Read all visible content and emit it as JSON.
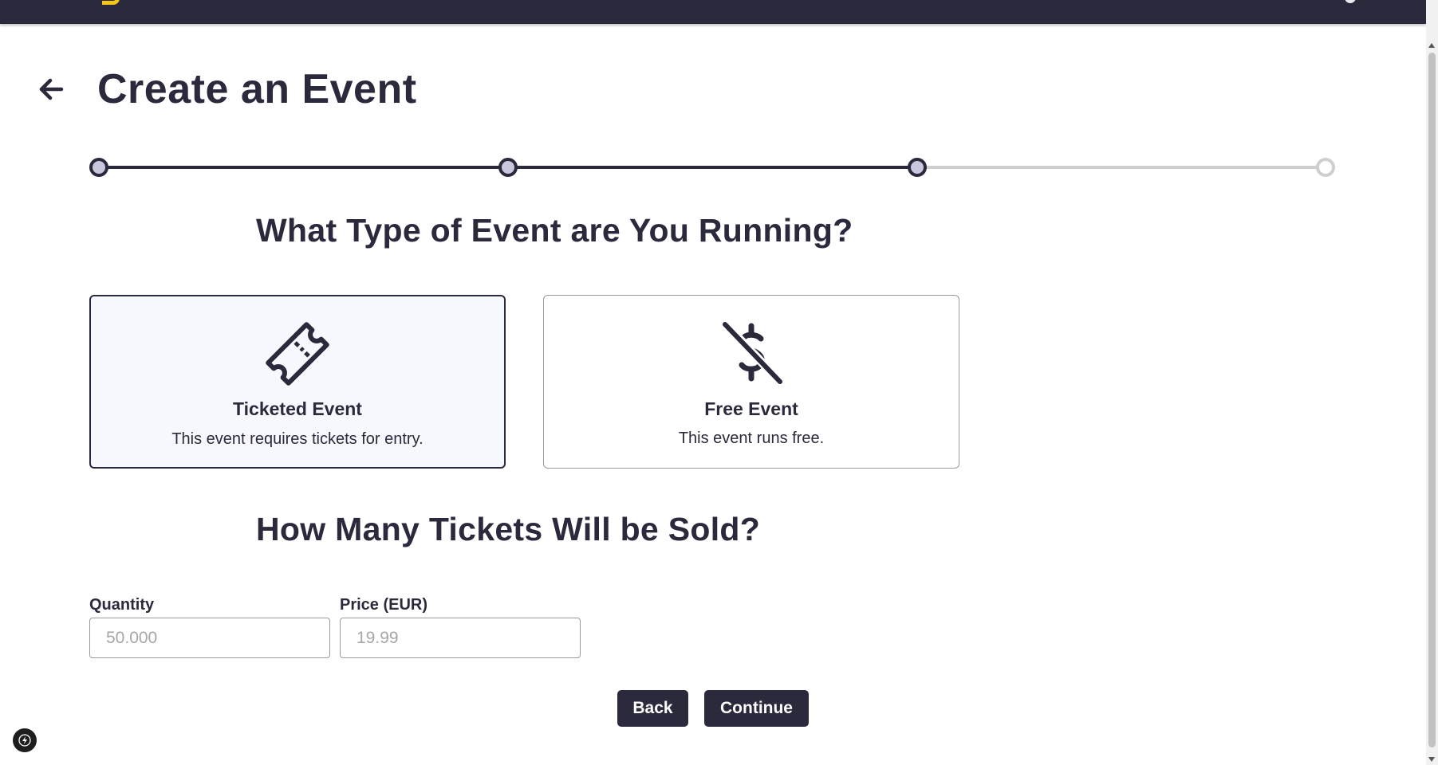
{
  "page": {
    "title": "Create an Event"
  },
  "stepper": {
    "steps_total": 4,
    "current_step": 3
  },
  "event_type": {
    "question": "What Type of Event are You Running?",
    "options": [
      {
        "title": "Ticketed Event",
        "description": "This event requires tickets for entry.",
        "icon": "ticket-icon",
        "selected": true
      },
      {
        "title": "Free Event",
        "description": "This event runs free.",
        "icon": "no-dollar-icon",
        "selected": false
      }
    ]
  },
  "tickets": {
    "question": "How Many Tickets Will be Sold?",
    "quantity": {
      "label": "Quantity",
      "placeholder": "50.000",
      "value": ""
    },
    "price": {
      "label": "Price (EUR)",
      "placeholder": "19.99",
      "value": ""
    }
  },
  "actions": {
    "back_label": "Back",
    "continue_label": "Continue"
  },
  "colors": {
    "primary": "#2b2a3d",
    "brand_accent": "#f5c518",
    "selected_card_bg": "#f5f9fe",
    "step_dot_fill": "#c9c7dd"
  }
}
